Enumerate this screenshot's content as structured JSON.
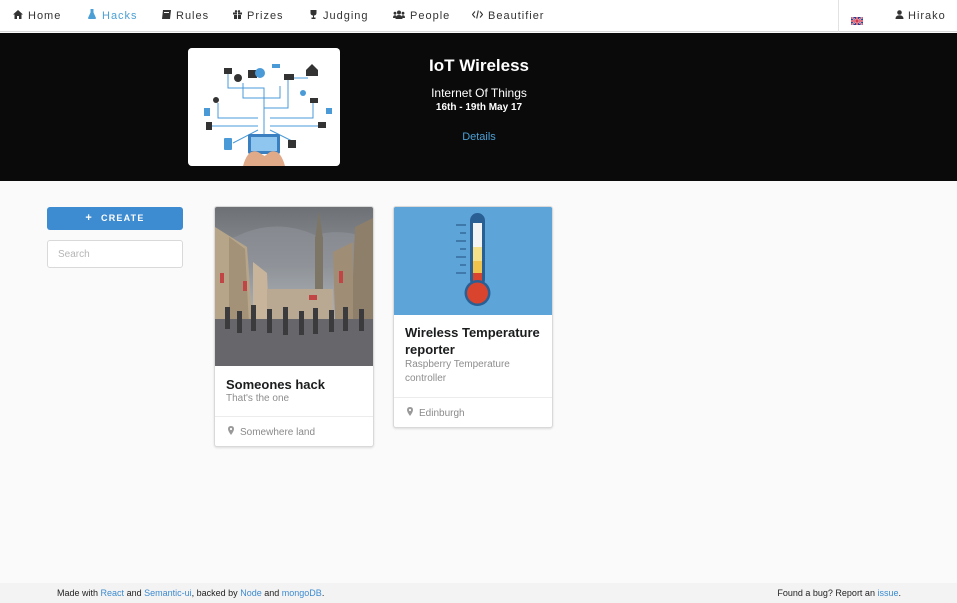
{
  "nav": {
    "items": [
      {
        "label": "Home",
        "icon": "home-icon"
      },
      {
        "label": "Hacks",
        "icon": "flask-icon",
        "active": true
      },
      {
        "label": "Rules",
        "icon": "book-icon"
      },
      {
        "label": "Prizes",
        "icon": "gift-icon"
      },
      {
        "label": "Judging",
        "icon": "trophy-icon"
      },
      {
        "label": "People",
        "icon": "users-icon"
      },
      {
        "label": "Beautifier",
        "icon": "code-icon"
      }
    ],
    "language_icon": "uk-flag-icon",
    "user": "Hirako"
  },
  "hero": {
    "title": "IoT Wireless",
    "subtitle": "Internet Of Things",
    "dates": "16th - 19th May 17",
    "details_link": "Details"
  },
  "sidebar": {
    "create_label": "CREATE",
    "search_placeholder": "Search"
  },
  "hacks": [
    {
      "title": "Someones hack",
      "description": "That's the one",
      "location": "Somewhere land"
    },
    {
      "title": "Wireless Temperature reporter",
      "description": "Raspberry Temperature controller",
      "location": "Edinburgh"
    }
  ],
  "colors": {
    "accent": "#3d8bd0",
    "hero_bg": "#0a0a0a",
    "link": "#4b9fd5"
  },
  "footer": {
    "made_with": "Made with",
    "react": "React",
    "and1": "and",
    "semantic": "Semantic-ui",
    "backed_by": ", backed by",
    "node": "Node",
    "and2": "and",
    "mongodb": "mongoDB",
    "period": ".",
    "bug_text": "Found a bug? Report an",
    "issue": "issue",
    "period2": "."
  }
}
